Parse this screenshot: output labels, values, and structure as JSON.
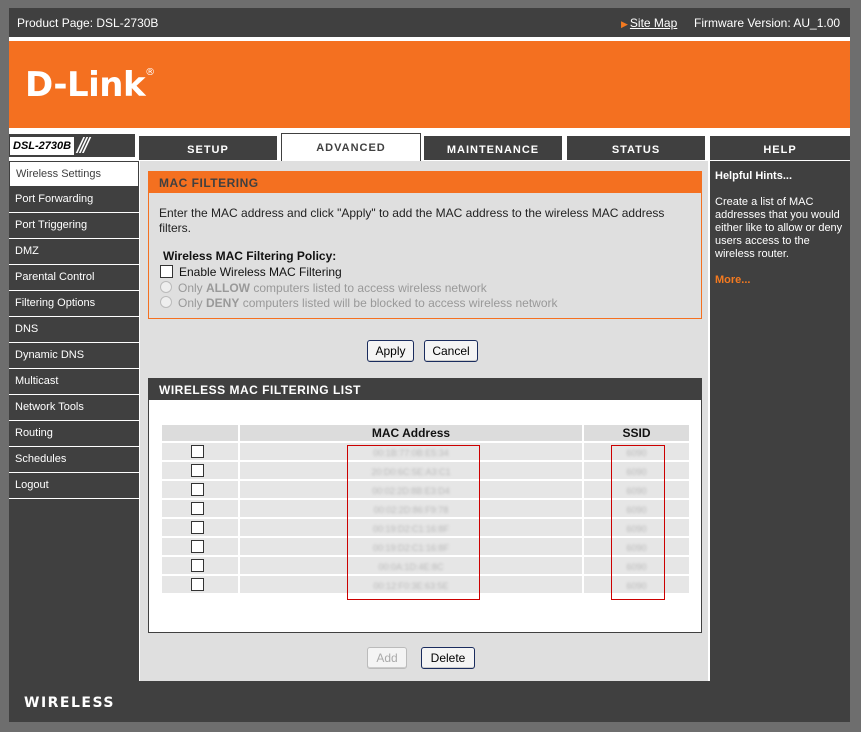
{
  "topbar": {
    "product": "Product Page: DSL-2730B",
    "sitemap": "Site Map",
    "firmware": "Firmware Version: AU_1.00"
  },
  "brand": {
    "logo": "D-Link",
    "reg": "®",
    "model": "DSL-2730B"
  },
  "tabs": [
    "SETUP",
    "ADVANCED",
    "MAINTENANCE",
    "STATUS",
    "HELP"
  ],
  "sidebar": [
    "Wireless Settings",
    "Port Forwarding",
    "Port Triggering",
    "DMZ",
    "Parental Control",
    "Filtering Options",
    "DNS",
    "Dynamic DNS",
    "Multicast",
    "Network Tools",
    "Routing",
    "Schedules",
    "Logout"
  ],
  "mac_filtering": {
    "title": "MAC FILTERING",
    "description": "Enter the MAC address and click \"Apply\" to add the MAC address to the wireless MAC address filters.",
    "policy_label": "Wireless MAC Filtering Policy:",
    "enable_label": "Enable Wireless MAC Filtering",
    "allow_pre": "Only ",
    "allow_kw": "ALLOW",
    "allow_post": " computers listed to access wireless network",
    "deny_pre": "Only ",
    "deny_kw": "DENY",
    "deny_post": " computers listed will be blocked to access wireless network"
  },
  "buttons": {
    "apply": "Apply",
    "cancel": "Cancel",
    "add": "Add",
    "delete": "Delete"
  },
  "list": {
    "title": "WIRELESS MAC FILTERING LIST",
    "columns": [
      "",
      "MAC Address",
      "SSID"
    ],
    "rows": [
      {
        "mac": "00:1B:77:0B:E5:34",
        "ssid": "6090"
      },
      {
        "mac": "20:D0:6C:5E:A3:C1",
        "ssid": "6090"
      },
      {
        "mac": "00:02:2D:8B:E3:D4",
        "ssid": "6090"
      },
      {
        "mac": "00:02:2D:86:F9:78",
        "ssid": "6090"
      },
      {
        "mac": "00:19:D2:C1:16:8F",
        "ssid": "6090"
      },
      {
        "mac": "00:19:D2:C1:16:8F",
        "ssid": "6090"
      },
      {
        "mac": "00:0A:1D:4E:8C",
        "ssid": "6090"
      },
      {
        "mac": "00:12:F0:3E:63:5E",
        "ssid": "6090"
      }
    ]
  },
  "hints": {
    "title": "Helpful Hints...",
    "text": "Create a list of MAC addresses that you would either like to allow or deny users access to the wireless router.",
    "more": "More..."
  },
  "footer": {
    "label": "WIRELESS"
  },
  "colors": {
    "orange": "#f47020",
    "dark": "#404040",
    "content_bg": "#dfdfdf"
  }
}
